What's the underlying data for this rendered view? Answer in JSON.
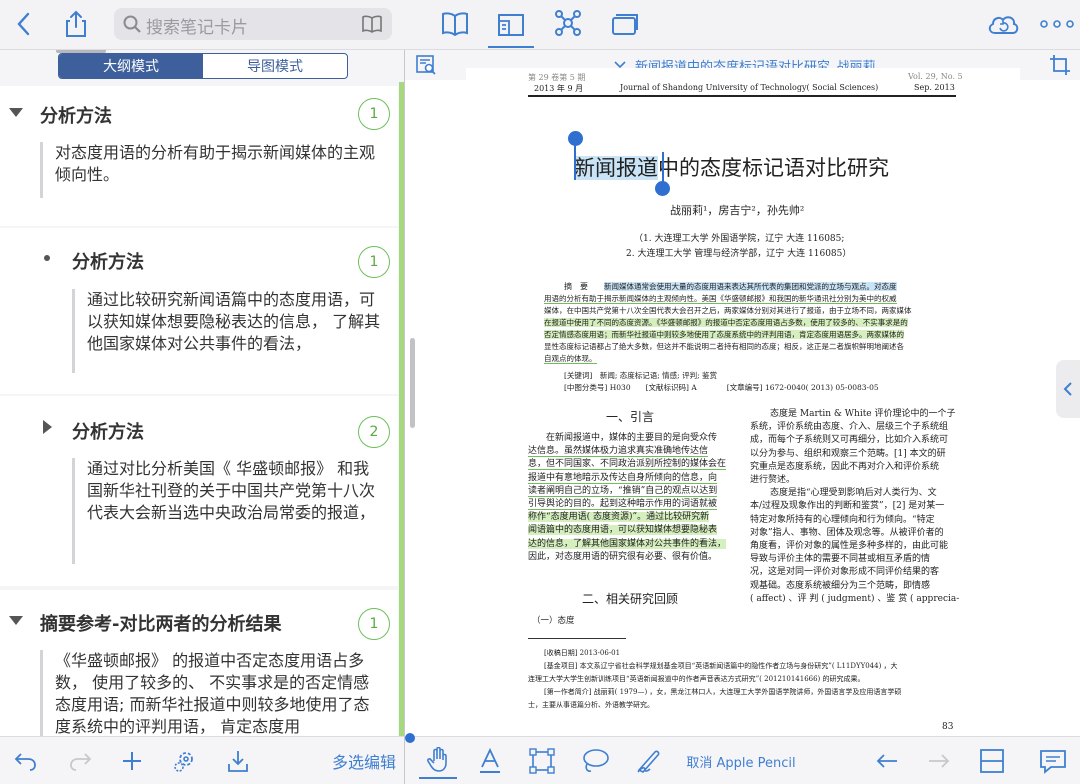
{
  "topbar": {
    "search_placeholder": "搜索笔记卡片",
    "icons": [
      "back-icon",
      "share-icon",
      "search-icon",
      "book-icon",
      "document-view-icon",
      "mindmap-icon",
      "cards-icon",
      "cloud-sync-icon",
      "more-icon"
    ]
  },
  "outline": {
    "mode_outline": "大纲模式",
    "mode_map": "导图模式",
    "items": [
      {
        "title": "分析方法",
        "count": "1",
        "level": 1,
        "expanded": true,
        "note": "对态度用语的分析有助于揭示新闻媒体的主观倾向性。"
      },
      {
        "title": "分析方法",
        "count": "1",
        "level": 2,
        "expanded": true,
        "note": "通过比较研究新闻语篇中的态度用语，可以获知媒体想要隐秘表达的信息， 了解其他国家媒体对公共事件的看法，"
      },
      {
        "title": "分析方法",
        "count": "2",
        "level": 2,
        "expanded": false,
        "note": "通过对比分析美国《 华盛顿邮报》 和我国新华社刊登的关于中国共产党第十八次代表大会新当选中央政治局常委的报道，"
      },
      {
        "title": "摘要参考-对比两者的分析结果",
        "count": "1",
        "level": 1,
        "expanded": true,
        "note": "《华盛顿邮报》 的报道中否定态度用语占多数， 使用了较多的、 不实事求是的否定情感态度用语; 而新华社报道中则较多地使用了态度系统中的评判用语， 肯定态度用"
      }
    ]
  },
  "document": {
    "title": "新闻报道中的态度标记语对比研究_战丽莉",
    "header_left_1": "第 29 卷第 5 期",
    "header_left_2": "2013 年 9 月",
    "header_center": "Journal of Shandong University of Technology( Social Sciences)",
    "header_right_1": "Vol. 29, No. 5",
    "header_right_2": "Sep. 2013",
    "paper_title_selected": "新闻报道",
    "paper_title_rest": "中的态度标记语对比研究",
    "authors": "战丽莉¹，房吉宁²，孙先帅²",
    "affil_1": "（1. 大连理工大学 外国语学院，辽宁 大连 116085;",
    "affil_2": "2. 大连理工大学 管理与经济学部，辽宁 大连 116085）",
    "abstract_label": "摘　要",
    "abstract_lines": [
      "新闻媒体通常会使用大量的态度用语来表达其所代表的集团和党派的立场与观点。对态度",
      "用语的分析有助于揭示新闻媒体的主观倾向性。美国《华盛顿邮报》和我国的新华通讯社分别为美中的权威",
      "媒体，在中国共产党第十八次全国代表大会召开之后，两家媒体分别对其进行了报道，由于立场不同，两家媒体",
      "在报道中使用了不同的态度资源。《华盛顿邮报》的报道中否定态度用语占多数，使用了较多的、不实事求是的",
      "否定情感态度用语；而新华社报道中则较多地使用了态度系统中的评判用语，肯定态度用语居多。两家媒体的",
      "显性态度标记语都占了绝大多数，但这并不能说明二者持有相同的态度；相反，这正是二者旗帜鲜明地阐述各",
      "自观点的体现。"
    ],
    "keywords": "[关键词]　新闻; 态度标记语; 情感; 评判; 鉴赏",
    "classification": "[中图分类号] H030　　[文献标识码] A　　　　[文章编号] 1672-0040( 2013) 05-0083-05",
    "section_1": "一、引言",
    "left_col": [
      "在新闻报道中，媒体的主要目的是向受众传",
      "达信息。虽然媒体极力追求真实准确地传达信",
      "息，但不同国家、不同政治派别所控制的媒体会在",
      "报道中有意地暗示及传达自身所倾向的信息，向",
      "读者阐明自己的立场，“推销”自己的观点以达到",
      "引导舆论的目的。起到这种暗示作用的词语就被",
      "称作“态度用语( 态度资源)”。通过比较研究新",
      "闻语篇中的态度用语，可以获知媒体想要隐秘表",
      "达的信息，了解其他国家媒体对公共事件的看法，",
      "因此，对态度用语的研究很有必要、很有价值。"
    ],
    "section_2": "二、相关研究回顾",
    "subsection": "（一）态度",
    "right_col": [
      "态度是 Martin & White 评价理论中的一个子",
      "系统，评价系统由态度、介入、层级三个子系统组",
      "成，而每个子系统则又可再细分，比如介入系统可",
      "以分为参与、组织和观察三个范畴。[1] 本文的研",
      "究重点是态度系统，因此不再对介入和评价系统",
      "进行赘述。",
      "态度是指“心理受到影响后对人类行为、文",
      "本/过程及现象作出的判断和鉴赏”，[2] 是对某一",
      "特定对象所持有的心理倾向和行为倾向。“特定",
      "对象”指人、事物、团体及观念等。从被评价者的",
      "角度看，评价对象的属性是多种多样的，由此可能",
      "导致与评价主体的需要不同甚或相互矛盾的情",
      "况，这是对同一评价对象形成不同评价结果的客",
      "观基础。态度系统被细分为三个范畴，即情感",
      "( affect) 、评 判 ( judgment) 、鉴 赏 ( apprecia-"
    ],
    "footnotes": [
      "[收稿日期] 2013-06-01",
      "[基金项目] 本文系辽宁省社会科学规划基金项目“英语新闻语篇中的隐性作者立场与身份研究”( L11DYY044) ，大",
      "连理工大学大学生创新训练项目“英语新闻报道中的作者声音表达方式研究”( 201210141666) 的研究成果。",
      "[第一作者简介] 战丽莉( 1979—) ，女，黑龙江林口人，大连理工大学外国语学院讲师，外国语言学及应用语言学硕",
      "士，主要从事语篇分析、外语教学研究。"
    ],
    "page_number": "83"
  },
  "bottombar": {
    "multi_edit": "多选编辑",
    "cancel_pencil": "取消 Apple Pencil",
    "icons": [
      "undo-icon",
      "redo-icon",
      "add-icon",
      "settings-icon",
      "export-icon",
      "hand-tool-icon",
      "text-tool-icon",
      "rect-tool-icon",
      "lasso-tool-icon",
      "pen-tool-icon",
      "arrow-left-icon",
      "arrow-right-icon",
      "split-view-icon",
      "comment-icon"
    ]
  },
  "colors": {
    "accent": "#3f7fd1",
    "badge_green": "#6fbe5a",
    "highlight_blue": "#c9e3f7",
    "highlight_green": "#d6efbf",
    "mode_active": "#3d5f9c"
  }
}
